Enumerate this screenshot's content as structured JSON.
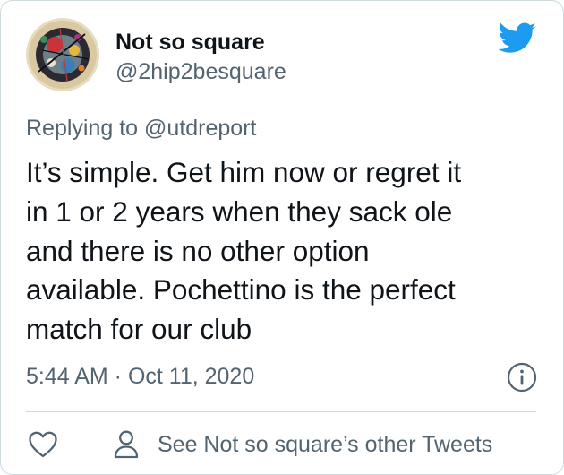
{
  "author": {
    "name": "Not so square",
    "handle": "@2hip2besquare"
  },
  "reply": {
    "prefix": "Replying to ",
    "mention": "@utdreport"
  },
  "tweet": {
    "text": "It’s simple. Get him now or regret it\nin 1 or 2 years when they sack ole\nand there is no other option\navailable. Pochettino is the perfect\nmatch for our club",
    "timestamp": "5:44 AM · Oct 11, 2020"
  },
  "actions": {
    "other_tweets_label": "See Not so square’s other Tweets"
  },
  "icons": {
    "brand": "twitter-bird-icon",
    "info": "info-icon",
    "like": "heart-icon",
    "profile": "person-icon"
  },
  "colors": {
    "brand_blue": "#1d9bf0",
    "text_primary": "#0f1419",
    "text_secondary": "#536471",
    "divider": "#cfd9de"
  }
}
